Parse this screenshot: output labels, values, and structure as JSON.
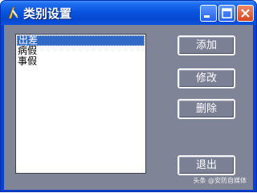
{
  "window": {
    "title": "类别设置"
  },
  "list": {
    "items": [
      "出差",
      "病假",
      "事假"
    ],
    "selected": "出差"
  },
  "buttons": {
    "add": "添加",
    "edit": "修改",
    "delete": "删除",
    "exit": "退出"
  },
  "watermark": "头条 @安防自媒体",
  "colors": {
    "titlebar": "#0a55e0",
    "client_background": "#7f8497",
    "selection": "#3169c6",
    "close_button": "#d8461f"
  },
  "icons": {
    "app": "pen-icon",
    "minimize": "minimize-icon",
    "maximize": "maximize-icon",
    "close": "close-icon"
  }
}
